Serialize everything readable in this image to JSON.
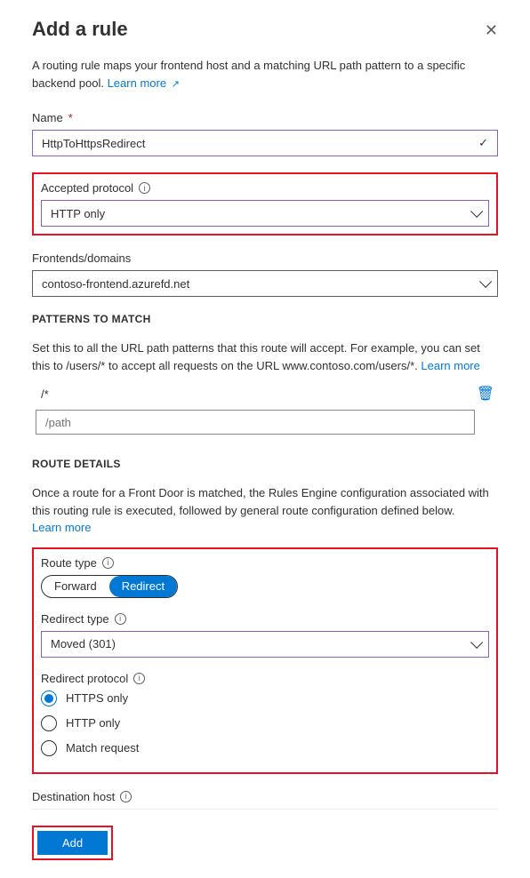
{
  "header": {
    "title": "Add a rule"
  },
  "intro": {
    "text": "A routing rule maps your frontend host and a matching URL path pattern to a specific backend pool. ",
    "learn_more": "Learn more"
  },
  "name": {
    "label": "Name",
    "value": "HttpToHttpsRedirect"
  },
  "protocol": {
    "label": "Accepted protocol",
    "value": "HTTP only"
  },
  "frontends": {
    "label": "Frontends/domains",
    "value": "contoso-frontend.azurefd.net"
  },
  "patterns": {
    "heading": "PATTERNS TO MATCH",
    "help_pre": "Set this to all the URL path patterns that this route will accept. For example, you can set this to /users/* to accept all requests on the URL www.contoso.com/users/*. ",
    "learn_more": "Learn more",
    "items": [
      "/*"
    ],
    "placeholder": "/path"
  },
  "route": {
    "heading": "ROUTE DETAILS",
    "help": "Once a route for a Front Door is matched, the Rules Engine configuration associated with this routing rule is executed, followed by general route configuration defined below.",
    "learn_more": "Learn more",
    "type_label": "Route type",
    "type_options": {
      "forward": "Forward",
      "redirect": "Redirect"
    },
    "redirect_type_label": "Redirect type",
    "redirect_type_value": "Moved (301)",
    "redirect_protocol_label": "Redirect protocol",
    "redirect_protocol_options": [
      "HTTPS only",
      "HTTP only",
      "Match request"
    ]
  },
  "destination": {
    "label": "Destination host"
  },
  "buttons": {
    "add": "Add"
  }
}
